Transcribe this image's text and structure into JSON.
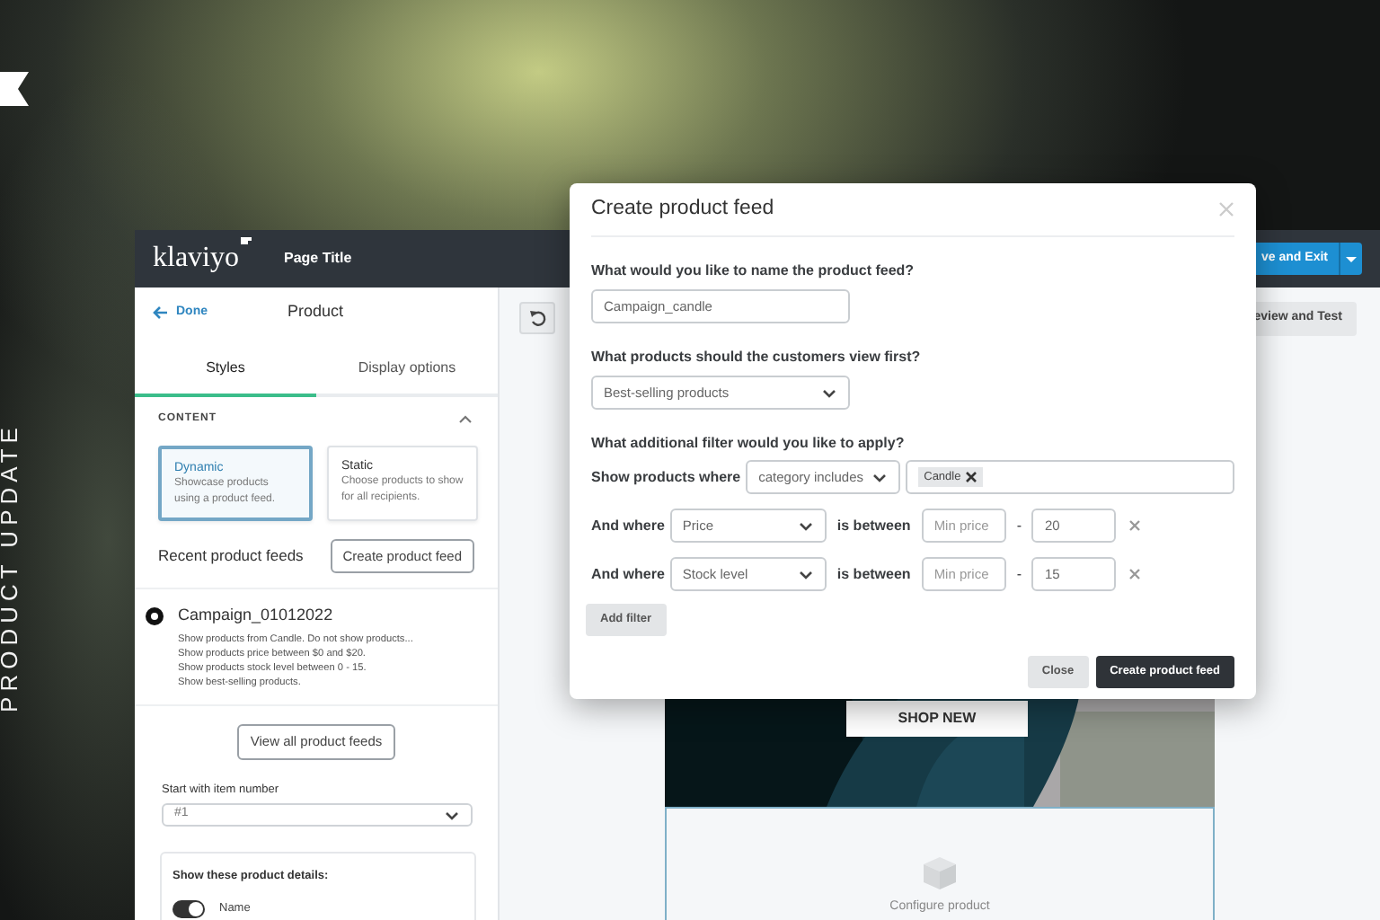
{
  "backdrop": {
    "banner": "PRODUCT UPDATE"
  },
  "app": {
    "logo": "klaviyo",
    "page_title": "Page Title",
    "save_button": "ve and Exit",
    "preview_button": "eview and Test"
  },
  "sidebar": {
    "back": "Done",
    "title": "Product",
    "tabs": [
      {
        "label": "Styles",
        "selected": true
      },
      {
        "label": "Display options",
        "selected": false
      }
    ],
    "section": {
      "label": "CONTENT",
      "expanded": true
    },
    "content_types": [
      {
        "title": "Dynamic",
        "description": "Showcase products using a product feed.",
        "selected": true
      },
      {
        "title": "Static",
        "description": "Choose products to show for all recipients.",
        "selected": false
      }
    ],
    "recent_heading": "Recent product feeds",
    "create_button": "Create product feed",
    "feeds": [
      {
        "name": "Campaign_01012022",
        "selected": true,
        "lines": [
          "Show products from Candle. Do not show products...",
          "Show products price between $0 and $20.",
          "Show products stock level between 0 - 15.",
          "Show best-selling products."
        ]
      }
    ],
    "view_all_button": "View all product feeds",
    "start_label": "Start with item number",
    "start_value": "#1",
    "details": {
      "heading": "Show these product details:",
      "toggles": [
        {
          "label": "Name",
          "on": true
        }
      ]
    }
  },
  "canvas": {
    "shop_button": "SHOP NEW",
    "placeholder": "Configure product"
  },
  "modal": {
    "title": "Create product feed",
    "name_label": "What would you like to name the product feed?",
    "name_value": "Campaign_candle",
    "order_label": "What products should the customers view first?",
    "order_value": "Best-selling products",
    "filter_label": "What additional filter would you like to apply?",
    "filters": [
      {
        "kind": "tags",
        "lead": "Show products where",
        "field": "category includes",
        "tags": [
          "Candle"
        ]
      },
      {
        "kind": "range",
        "lead": "And where",
        "field": "Price",
        "connector": "is between",
        "min_placeholder": "Min price",
        "separator": "-",
        "max": "20"
      },
      {
        "kind": "range",
        "lead": "And where",
        "field": "Stock level",
        "connector": "is between",
        "min_placeholder": "Min price",
        "separator": "-",
        "max": "15"
      }
    ],
    "add_filter": "Add filter",
    "close_button": "Close",
    "submit_button": "Create product feed"
  }
}
